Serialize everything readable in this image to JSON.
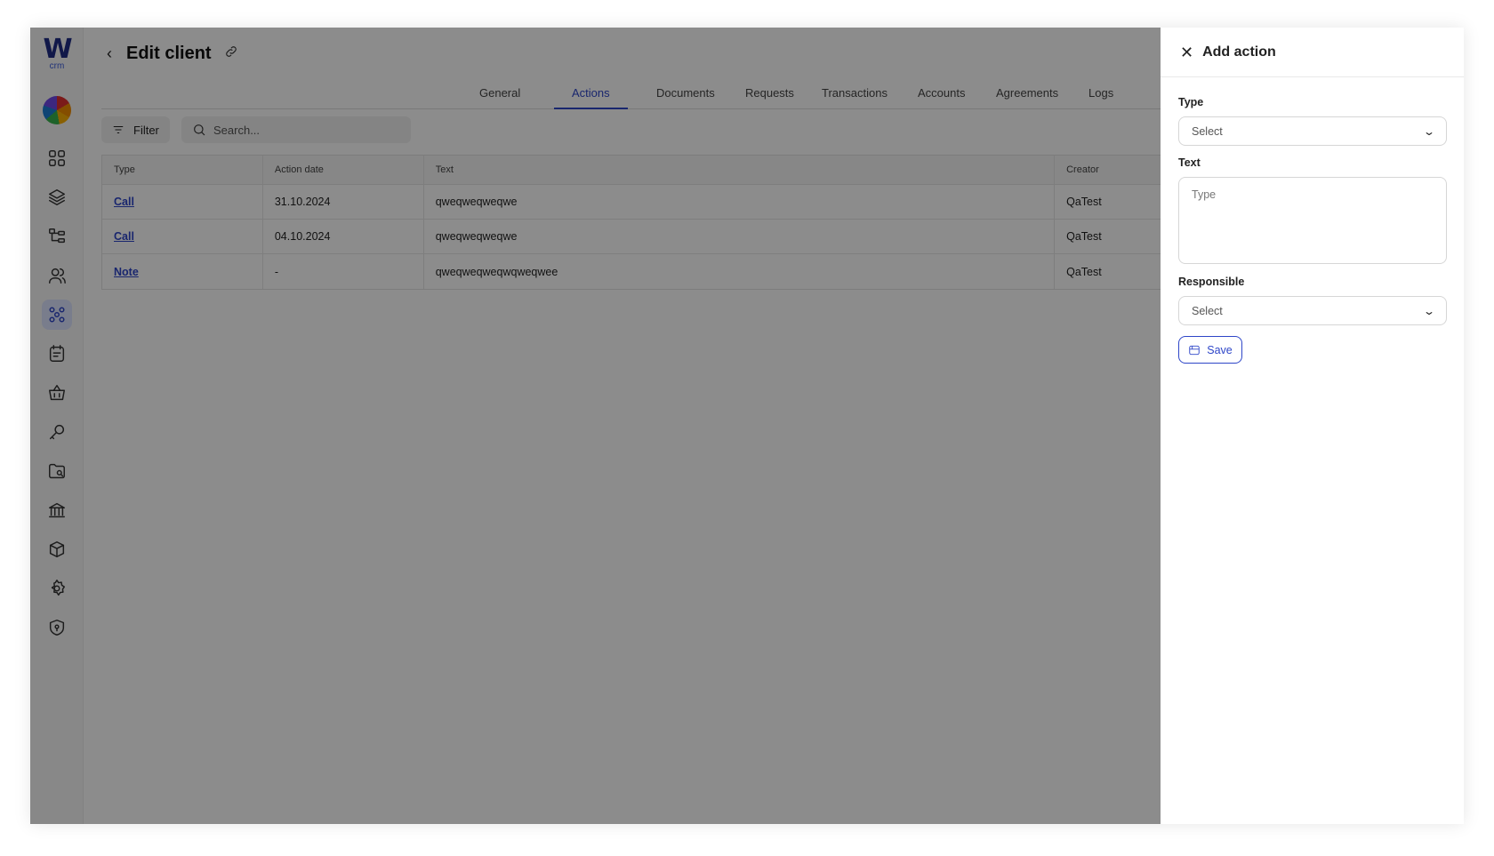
{
  "header": {
    "title": "Edit client"
  },
  "logo": {
    "mark": "W",
    "sub": "crm"
  },
  "sidebar": {
    "items": [
      {
        "icon": "dashboard-icon"
      },
      {
        "icon": "layers-icon"
      },
      {
        "icon": "hierarchy-icon"
      },
      {
        "icon": "users-icon"
      },
      {
        "icon": "clients-icon",
        "active": true
      },
      {
        "icon": "tasks-icon"
      },
      {
        "icon": "basket-icon"
      },
      {
        "icon": "key-icon"
      },
      {
        "icon": "folder-search-icon"
      },
      {
        "icon": "bank-icon"
      },
      {
        "icon": "package-icon"
      },
      {
        "icon": "settings-icon"
      },
      {
        "icon": "shield-icon"
      }
    ]
  },
  "tabs": [
    {
      "label": "General"
    },
    {
      "label": "Actions",
      "active": true
    },
    {
      "label": "Documents"
    },
    {
      "label": "Requests"
    },
    {
      "label": "Transactions"
    },
    {
      "label": "Accounts"
    },
    {
      "label": "Agreements"
    },
    {
      "label": "Logs"
    }
  ],
  "toolbar": {
    "filter_label": "Filter",
    "search_placeholder": "Search..."
  },
  "table": {
    "columns": [
      "Type",
      "Action date",
      "Text",
      "Creator"
    ],
    "rows": [
      {
        "type": "Call",
        "date": "31.10.2024",
        "text": "qweqweqweqwe",
        "creator": "QaTest"
      },
      {
        "type": "Call",
        "date": "04.10.2024",
        "text": "qweqweqweqwe",
        "creator": "QaTest"
      },
      {
        "type": "Note",
        "date": "-",
        "text": "qweqweqweqwqweqwee",
        "creator": "QaTest"
      }
    ]
  },
  "panel": {
    "title": "Add action",
    "type_label": "Type",
    "type_value": "Select",
    "text_label": "Text",
    "text_placeholder": "Type",
    "responsible_label": "Responsible",
    "responsible_value": "Select",
    "save_label": "Save"
  },
  "colors": {
    "accent": "#2e46c8",
    "overlay": "rgba(0,0,0,0.45)"
  }
}
